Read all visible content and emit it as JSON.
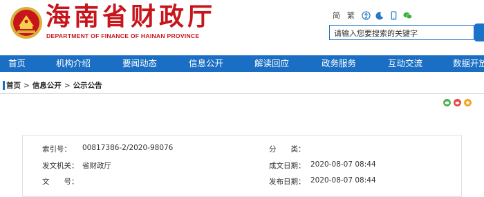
{
  "header": {
    "logo_cn": "海南省财政厅",
    "logo_en": "DEPARTMENT OF FINANCE OF HAINAN PROVINCE",
    "lang_simplified": "简",
    "lang_traditional": "繁",
    "search_placeholder": "请输入您要搜索的关键字"
  },
  "nav": {
    "items": [
      "首页",
      "机构介绍",
      "要闻动态",
      "信息公开",
      "解读回应",
      "政务服务",
      "互动交流",
      "数据开放"
    ]
  },
  "breadcrumb": {
    "home": "首页",
    "sep": ">",
    "level1": "信息公开",
    "level2": "公示公告"
  },
  "meta": {
    "index_label": "索引号：",
    "index_value": "00817386-2/2020-98076",
    "category_label": "分　　类：",
    "category_value": "",
    "issuer_label": "发文机关：",
    "issuer_value": "省财政厅",
    "created_label": "成文日期：",
    "created_value": "2020-08-07 08:44",
    "docno_label": "文　　号：",
    "docno_value": "",
    "published_label": "发布日期：",
    "published_value": "2020-08-07 08:44"
  },
  "colors": {
    "brand_red": "#c8141b",
    "nav_blue": "#1a6fc4",
    "share_green": "#4cae4c",
    "share_red": "#e8453c",
    "share_orange": "#f4a11a"
  }
}
